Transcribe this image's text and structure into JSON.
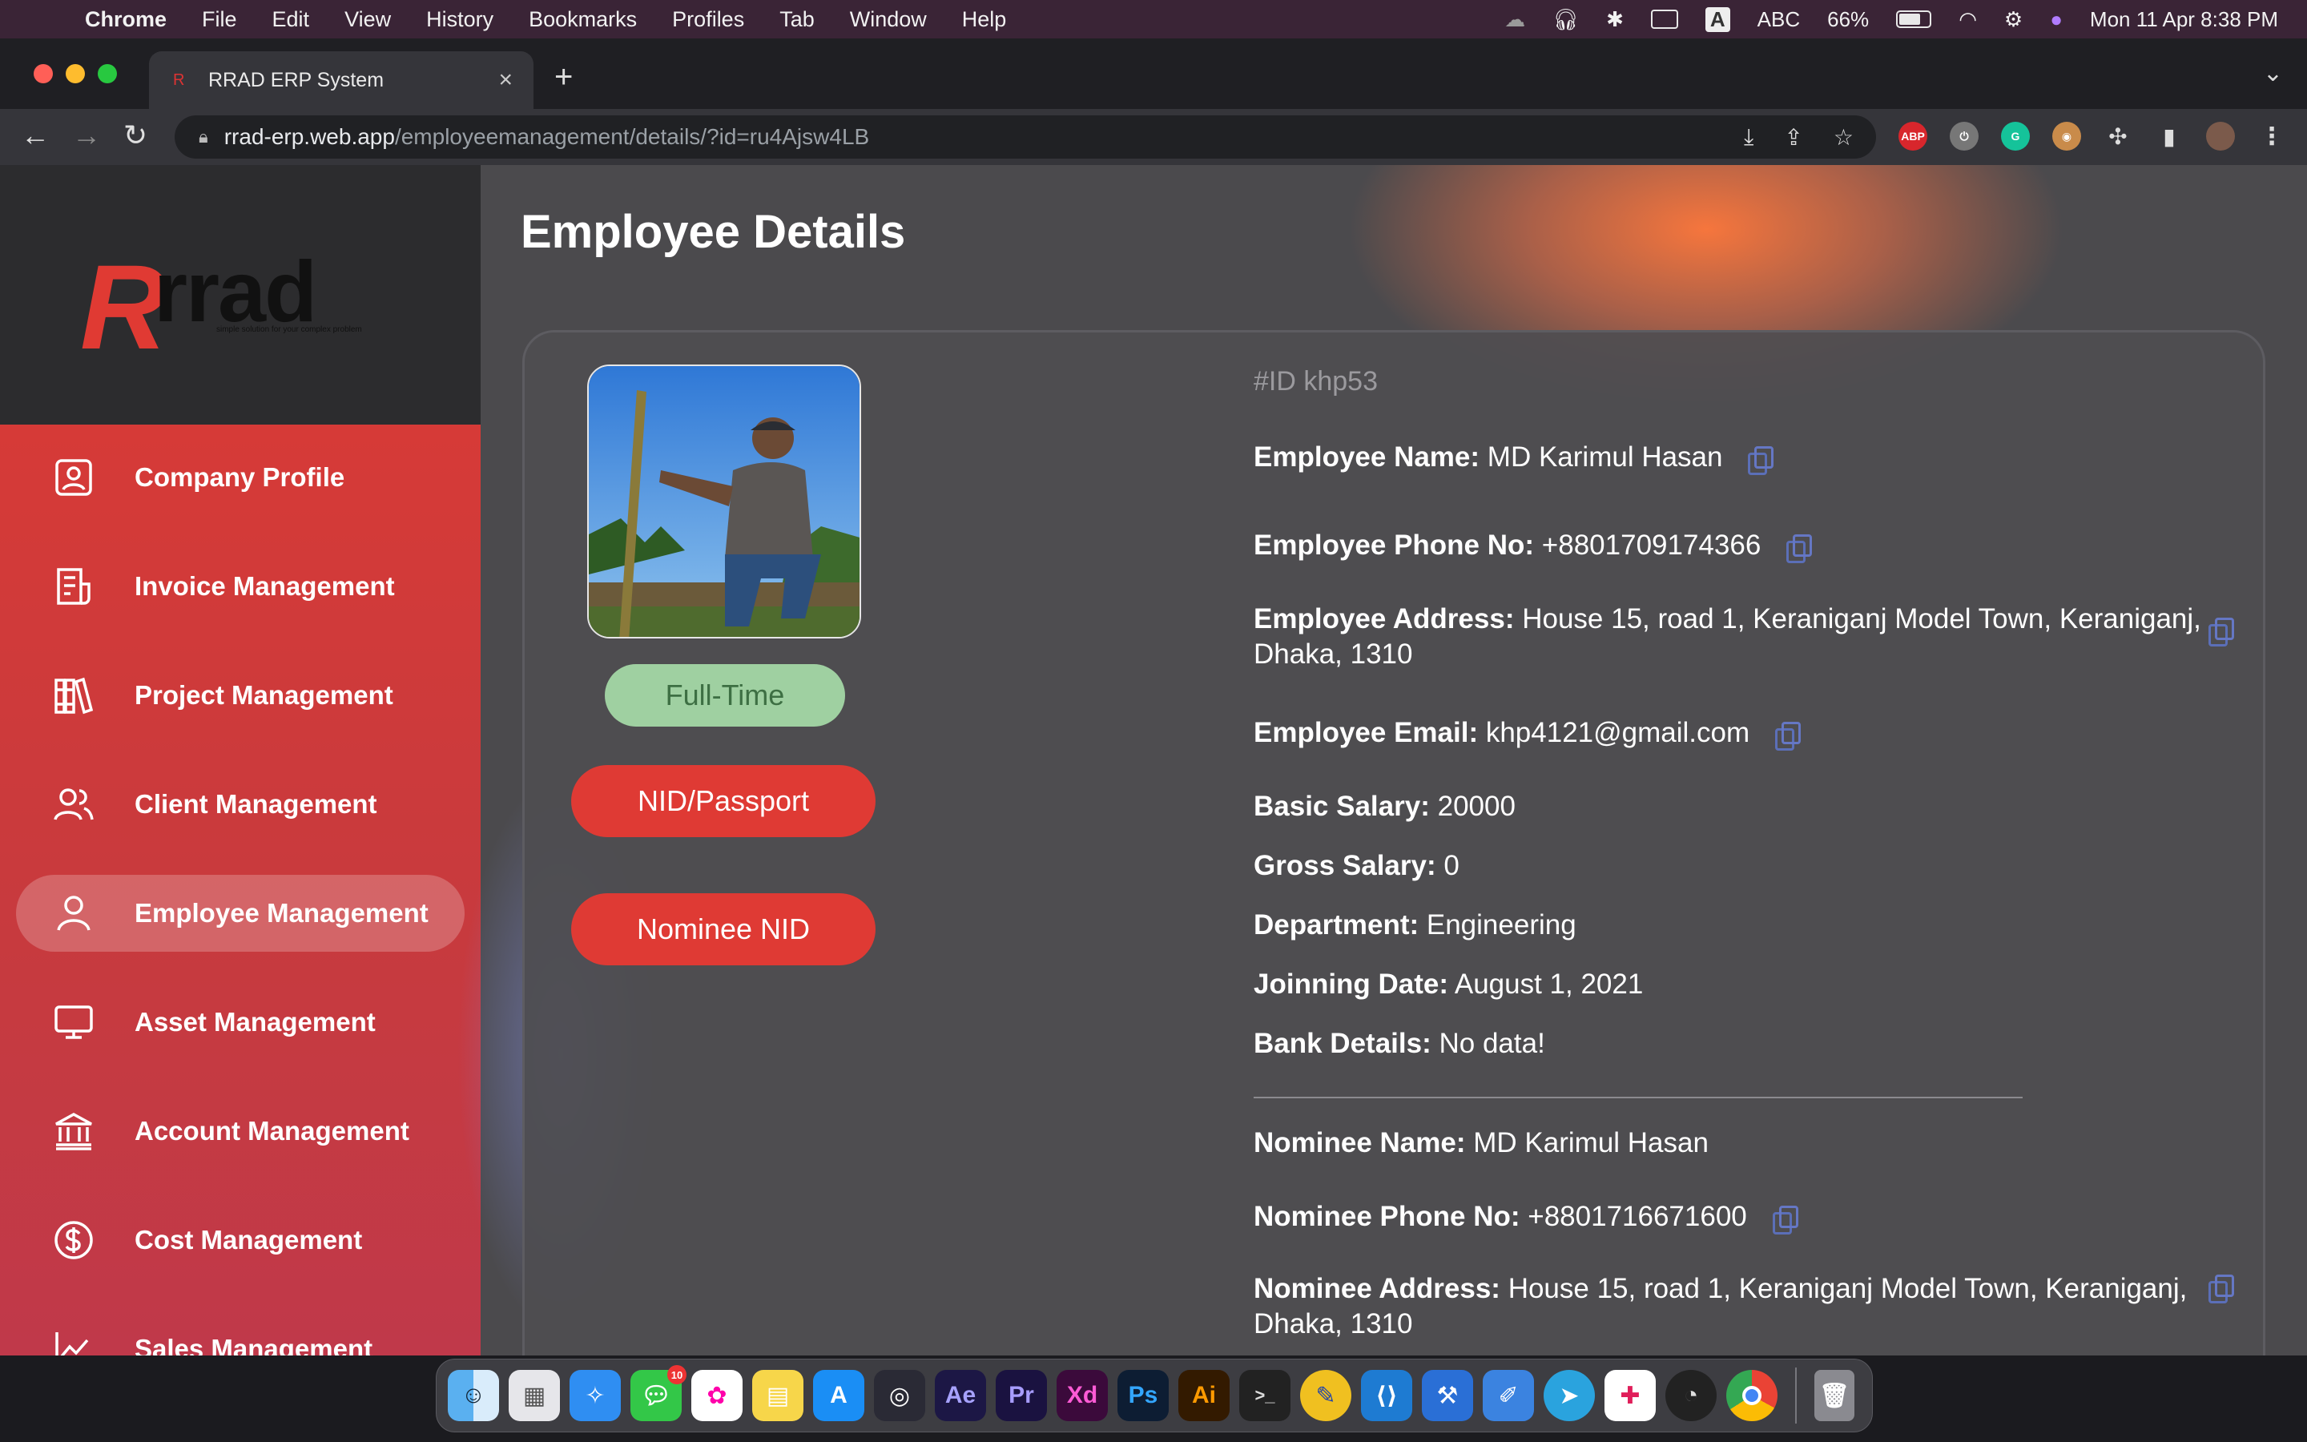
{
  "menubar": {
    "app": "Chrome",
    "items": [
      "File",
      "Edit",
      "View",
      "History",
      "Bookmarks",
      "Profiles",
      "Tab",
      "Window",
      "Help"
    ],
    "input_source": "ABC",
    "battery": "66%",
    "datetime": "Mon 11 Apr  8:38 PM"
  },
  "browser": {
    "tab_title": "RRAD ERP System",
    "url_host": "rrad-erp.web.app",
    "url_path": "/employeemanagement/details/?id=ru4Ajsw4LB",
    "extensions": [
      "ABP",
      "G"
    ]
  },
  "logo": {
    "mark": "R",
    "text": "rrad",
    "tagline": "simple solution for your complex problem"
  },
  "sidebar": {
    "items": [
      {
        "label": "Company Profile",
        "icon": "profile-card-icon"
      },
      {
        "label": "Invoice Management",
        "icon": "invoice-icon"
      },
      {
        "label": "Project Management",
        "icon": "books-icon"
      },
      {
        "label": "Client Management",
        "icon": "users-icon"
      },
      {
        "label": "Employee Management",
        "icon": "user-icon",
        "active": true
      },
      {
        "label": "Asset Management",
        "icon": "monitor-icon"
      },
      {
        "label": "Account Management",
        "icon": "bank-icon"
      },
      {
        "label": "Cost Management",
        "icon": "dollar-icon"
      },
      {
        "label": "Sales Management",
        "icon": "chart-icon"
      }
    ]
  },
  "main": {
    "title": "Employee Details",
    "employment_type": "Full-Time",
    "nid_button": "NID/Passport",
    "nominee_nid_button": "Nominee NID",
    "id_line": "#ID khp53",
    "fields": {
      "name_label": "Employee Name:",
      "name_value": "MD Karimul Hasan",
      "phone_label": "Employee Phone No:",
      "phone_value": "+8801709174366",
      "address_label": "Employee Address:",
      "address_value_1": "House 15, road 1, Keraniganj Model Town, Keraniganj,",
      "address_value_2": "Dhaka, 1310",
      "email_label": "Employee Email:",
      "email_value": "khp4121@gmail.com",
      "basic_salary_label": "Basic Salary:",
      "basic_salary_value": "20000",
      "gross_salary_label": "Gross Salary:",
      "gross_salary_value": "0",
      "department_label": "Department:",
      "department_value": "Engineering",
      "joining_label": "Joinning Date:",
      "joining_value": "August 1, 2021",
      "bank_label": "Bank Details:",
      "bank_value": "No data!",
      "nominee_name_label": "Nominee Name:",
      "nominee_name_value": "MD Karimul Hasan",
      "nominee_phone_label": "Nominee Phone No:",
      "nominee_phone_value": "+8801716671600",
      "nominee_address_label": "Nominee Address:",
      "nominee_address_value_1": "House 15, road 1, Keraniganj Model Town, Keraniganj,",
      "nominee_address_value_2": "Dhaka, 1310"
    }
  },
  "dock": {
    "apps": [
      "Finder",
      "Launchpad",
      "Safari",
      "Messages",
      "Photos",
      "Notes",
      "App Store",
      "DaVinci Resolve",
      "Ae",
      "Pr",
      "Xd",
      "Ps",
      "Ai",
      "Terminal",
      "Vectornator",
      "VS Code",
      "Xcode",
      "Figma",
      "Telegram",
      "Slack",
      "OBS",
      "Chrome",
      "Trash"
    ],
    "messages_badge": "10"
  },
  "colors": {
    "sidebar_red": "#d63a37",
    "button_red": "#df3a34",
    "fulltime_green": "#9fd0a1",
    "copy_icon_blue": "#5b6fb8"
  }
}
